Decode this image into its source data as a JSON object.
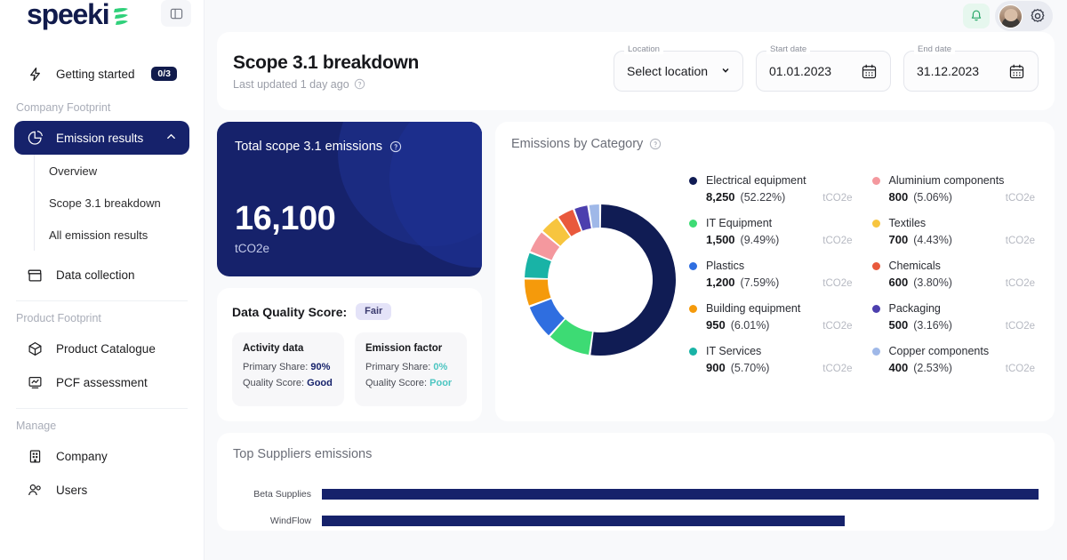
{
  "brand": {
    "name": "speeki",
    "logo_icon": "speeki-leaf-logo"
  },
  "sidebar": {
    "panel_toggle_icon": "panel-layout-icon",
    "getting_started": {
      "label": "Getting started",
      "icon": "lightning-bolt-icon",
      "badge": "0/3"
    },
    "sections": [
      {
        "label": "Company Footprint",
        "items": [
          {
            "label": "Emission results",
            "icon": "pie-chart-icon",
            "active": true,
            "chevron": "chevron-up-icon",
            "children": [
              {
                "label": "Overview"
              },
              {
                "label": "Scope 3.1 breakdown"
              },
              {
                "label": "All emission results"
              }
            ]
          },
          {
            "label": "Data collection",
            "icon": "box-icon",
            "active": false
          }
        ]
      },
      {
        "label": "Product Footprint",
        "items": [
          {
            "label": "Product Catalogue",
            "icon": "cube-icon",
            "active": false
          },
          {
            "label": "PCF assessment",
            "icon": "chart-monitor-icon",
            "active": false
          }
        ]
      },
      {
        "label": "Manage",
        "items": [
          {
            "label": "Company",
            "icon": "building-icon",
            "active": false
          },
          {
            "label": "Users",
            "icon": "users-icon",
            "active": false
          }
        ]
      }
    ]
  },
  "topbar": {
    "notification_icon": "bell-icon",
    "settings_icon": "gear-icon",
    "avatar": "user-avatar"
  },
  "header": {
    "title": "Scope 3.1 breakdown",
    "subtitle": "Last updated 1 day ago",
    "subtitle_info_icon": "info-circle-icon",
    "location": {
      "legend": "Location",
      "value": "Select location",
      "caret_icon": "caret-down-icon"
    },
    "start_date": {
      "legend": "Start date",
      "value": "01.01.2023",
      "icon": "calendar-icon"
    },
    "end_date": {
      "legend": "End date",
      "value": "31.12.2023",
      "icon": "calendar-icon"
    }
  },
  "total_card": {
    "title": "Total scope 3.1 emissions",
    "info_icon": "info-circle-icon",
    "value": "16,100",
    "unit": "tCO2e",
    "bg_color": "#16226b"
  },
  "data_quality": {
    "title": "Data Quality Score:",
    "badge": "Fair",
    "boxes": [
      {
        "title": "Activity data",
        "primary_share_label": "Primary Share:",
        "primary_share_value": "90%",
        "quality_label": "Quality Score:",
        "quality_value": "Good",
        "value_color": "#16226b"
      },
      {
        "title": "Emission factor",
        "primary_share_label": "Primary Share:",
        "primary_share_value": "0%",
        "quality_label": "Quality Score:",
        "quality_value": "Poor",
        "value_color": "#4cc5c1"
      }
    ]
  },
  "chart_card": {
    "title": "Emissions by Category",
    "info_icon": "info-circle-icon",
    "unit": "tCO2e"
  },
  "chart_data": {
    "type": "pie",
    "title": "Emissions by Category",
    "unit": "tCO2e",
    "total": 16100,
    "categories": [
      "Electrical equipment",
      "IT Equipment",
      "Plastics",
      "Building equipment",
      "IT Services",
      "Aluminium components",
      "Textiles",
      "Chemicals",
      "Packaging",
      "Copper components"
    ],
    "values": [
      8250,
      1500,
      1200,
      950,
      900,
      800,
      700,
      600,
      500,
      400
    ],
    "value_labels": [
      "8,250",
      "1,500",
      "1,200",
      "950",
      "900",
      "800",
      "700",
      "600",
      "500",
      "400"
    ],
    "percents": [
      "52.22%",
      "9.49%",
      "7.59%",
      "6.01%",
      "5.70%",
      "5.06%",
      "4.43%",
      "3.80%",
      "3.16%",
      "2.53%"
    ],
    "percent_values": [
      52.22,
      9.49,
      7.59,
      6.01,
      5.7,
      5.06,
      4.43,
      3.8,
      3.16,
      2.53
    ],
    "colors": [
      "#101c54",
      "#3ddb74",
      "#2f6ee0",
      "#f59a0b",
      "#19b3a6",
      "#f4989e",
      "#f7c53f",
      "#e9593c",
      "#4c3fae",
      "#9fb8e8"
    ],
    "legend_position": "right",
    "donut": true
  },
  "suppliers": {
    "title": "Top Suppliers emissions",
    "chart_data": {
      "type": "bar",
      "orientation": "horizontal",
      "title": "Top Suppliers emissions",
      "categories": [
        "Beta Supplies",
        "WindFlow"
      ],
      "values": [
        100,
        73
      ],
      "color": "#16226b"
    }
  }
}
